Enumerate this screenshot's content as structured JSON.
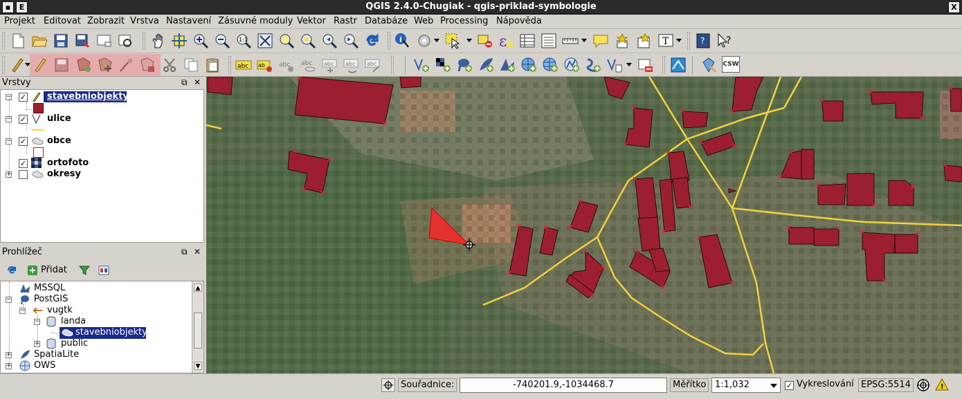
{
  "window": {
    "title": "QGIS 2.4.0-Chugiak - qgis-priklad-symbologie",
    "menu_glyph": "E",
    "close_glyph": "X"
  },
  "menubar": {
    "items": [
      "Projekt",
      "Editovat",
      "Zobrazit",
      "Vrstva",
      "Nastavení",
      "Zásuvné moduly",
      "Vektor",
      "Rastr",
      "Databáze",
      "Web",
      "Processing",
      "Nápověda"
    ]
  },
  "layers_panel": {
    "title": "Vrstvy",
    "layers": [
      {
        "name": "stavebniobjekty",
        "checked": true,
        "selected": true
      },
      {
        "name": "ulice",
        "checked": true,
        "selected": false
      },
      {
        "name": "obce",
        "checked": true,
        "selected": false
      },
      {
        "name": "ortofoto",
        "checked": true,
        "selected": false
      },
      {
        "name": "okresy",
        "checked": false,
        "selected": false
      }
    ],
    "colors": {
      "buildings": "#9b1f2e",
      "streets": "#f3d23a",
      "obce_outline": "#c0202a"
    }
  },
  "browser_panel": {
    "title": "Prohlížeč",
    "add_label": "Přidat",
    "items": [
      {
        "label": "MSSQL"
      },
      {
        "label": "PostGIS"
      },
      {
        "label": "vugtk"
      },
      {
        "label": "landa"
      },
      {
        "label": "stavebniobjekty",
        "selected": true
      },
      {
        "label": "public"
      },
      {
        "label": "SpatiaLite"
      },
      {
        "label": "OWS"
      }
    ]
  },
  "toolbar2": {
    "csw_label": "CSW",
    "abc_label": "abc"
  },
  "status": {
    "coord_label": "Souřadnice:",
    "coord_value": "-740201.9,-1034468.7",
    "scale_label": "Měřítko",
    "scale_value": "1:1,032",
    "render_label": "Vykreslování",
    "render_checked": true,
    "crs": "EPSG:5514"
  },
  "map": {
    "colors": {
      "building_fill": "#9b1f2e",
      "street": "#f3d23a",
      "vertex": "#e0242a",
      "ortho_base": "#5a6e4c"
    }
  }
}
